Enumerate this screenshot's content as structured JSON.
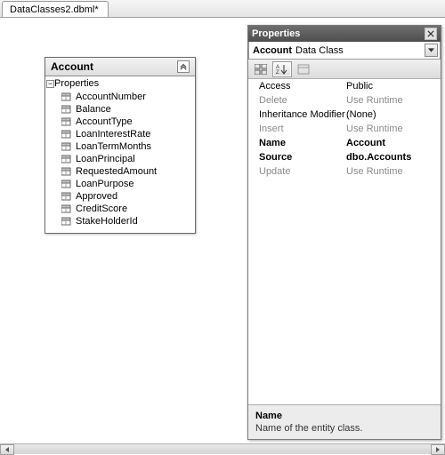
{
  "tab": {
    "label": "DataClasses2.dbml*"
  },
  "entity": {
    "title": "Account",
    "section_label": "Properties",
    "properties": [
      "AccountNumber",
      "Balance",
      "AccountType",
      "LoanInterestRate",
      "LoanTermMonths",
      "LoanPrincipal",
      "RequestedAmount",
      "LoanPurpose",
      "Approved",
      "CreditScore",
      "StakeHolderId"
    ]
  },
  "panel": {
    "title": "Properties",
    "object_name": "Account",
    "object_type": "Data Class",
    "grid": [
      {
        "label": "Access",
        "value": "Public",
        "style": "normal"
      },
      {
        "label": "Delete",
        "value": "Use Runtime",
        "style": "dim"
      },
      {
        "label": "Inheritance Modifier",
        "value": "(None)",
        "style": "normal"
      },
      {
        "label": "Insert",
        "value": "Use Runtime",
        "style": "dim"
      },
      {
        "label": "Name",
        "value": "Account",
        "style": "bold"
      },
      {
        "label": "Source",
        "value": "dbo.Accounts",
        "style": "bold"
      },
      {
        "label": "Update",
        "value": "Use Runtime",
        "style": "dim"
      }
    ],
    "description": {
      "title": "Name",
      "text": "Name of the entity class."
    }
  }
}
